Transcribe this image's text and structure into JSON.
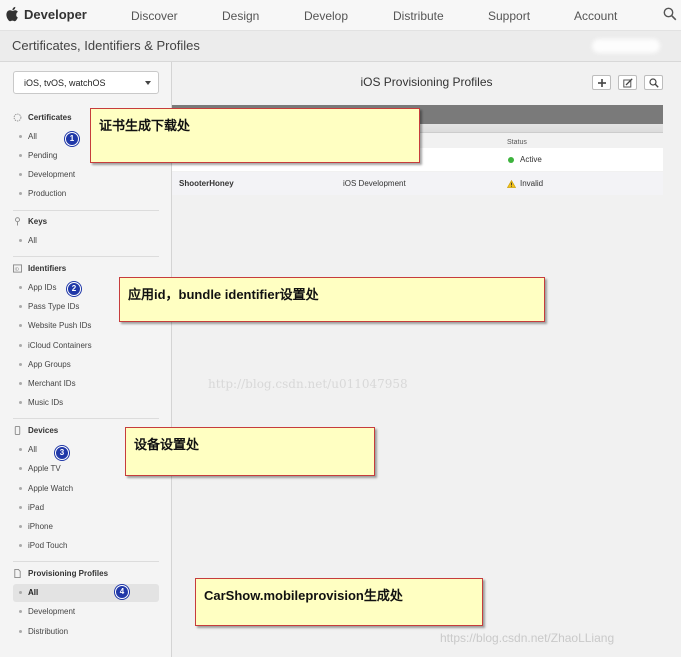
{
  "topnav": {
    "brand": "Developer",
    "items": [
      "Discover",
      "Design",
      "Develop",
      "Distribute",
      "Support",
      "Account"
    ]
  },
  "subheader": {
    "title": "Certificates, Identifiers & Profiles"
  },
  "sidebar": {
    "platform": "iOS, tvOS, watchOS",
    "sections": [
      {
        "title": "Certificates",
        "items": [
          "All",
          "Pending",
          "Development",
          "Production"
        ]
      },
      {
        "title": "Keys",
        "items": [
          "All"
        ]
      },
      {
        "title": "Identifiers",
        "items": [
          "App IDs",
          "Pass Type IDs",
          "Website Push IDs",
          "iCloud Containers",
          "App Groups",
          "Merchant IDs",
          "Music IDs"
        ]
      },
      {
        "title": "Devices",
        "items": [
          "All",
          "Apple TV",
          "Apple Watch",
          "iPad",
          "iPhone",
          "iPod Touch"
        ]
      },
      {
        "title": "Provisioning Profiles",
        "items": [
          "All",
          "Development",
          "Distribution"
        ]
      }
    ]
  },
  "main": {
    "title": "iOS Provisioning Profiles",
    "columns": {
      "status": "Status"
    },
    "rows": [
      {
        "name": "",
        "type": "",
        "status": "Active"
      },
      {
        "name": "ShooterHoney",
        "type": "iOS Development",
        "status": "Invalid"
      }
    ]
  },
  "colors": {
    "active": "#3db33d",
    "warning": "#f2c21a",
    "note_border": "#c63c3c",
    "note_fill": "#ffffc2",
    "badge": "#2038a8"
  },
  "annotations": [
    {
      "badge": "1",
      "text": "证书生成下载处"
    },
    {
      "badge": "2",
      "text": "应用id，bundle identifier设置处"
    },
    {
      "badge": "3",
      "text": "设备设置处"
    },
    {
      "badge": "4",
      "text": "CarShow.mobileprovision生成处"
    }
  ],
  "watermarks": [
    "http://blog.csdn.net/u011047958",
    "https://blog.csdn.net/ZhaoLLiang"
  ]
}
